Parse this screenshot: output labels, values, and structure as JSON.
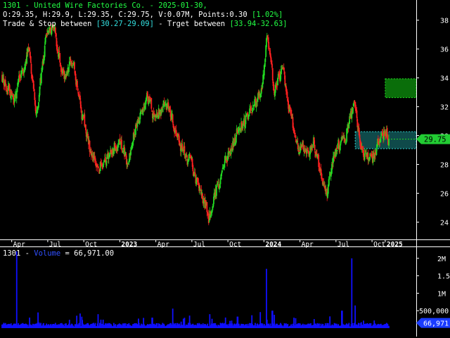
{
  "header": {
    "title": "1301 - United Wire Factories Co. - 2025-01-30,",
    "ohlc": "O:29.35, H:29.9, L:29.35, C:29.75, V:0.07M, Points:0.30",
    "change_pct": "[1.02%]",
    "trade_stop_label": "Trade & Stop between",
    "trade_stop_range": "[30.27-29.09]",
    "separator": " - ",
    "target_label": "Trget between",
    "target_range": "[33.94-32.63]"
  },
  "volume_header": {
    "symbol": "1301 - ",
    "label": "Volume",
    "value_text": " = 66,971.00"
  },
  "colors": {
    "background": "#000000",
    "up_candle": "#22dd22",
    "down_candle": "#ff2020",
    "volume_bar": "#1010ff",
    "trade_zone": "#0f4a4a",
    "target_zone": "#0a6e0a",
    "price_badge": "#22cc33",
    "volume_badge": "#1a3cff"
  },
  "chart_data": [
    {
      "type": "candlestick",
      "title": "1301 - United Wire Factories Co.",
      "x_tick_labels": [
        "Apr",
        "Jul",
        "Oct",
        "2023",
        "Apr",
        "Jul",
        "Oct",
        "2024",
        "Apr",
        "Jul",
        "Oct",
        "2025"
      ],
      "y_tick_labels": [
        "24",
        "26",
        "28",
        "30",
        "32",
        "34",
        "36",
        "38"
      ],
      "ylim": [
        22.8,
        39.4
      ],
      "last_price": 29.75,
      "last_price_label": "29.75",
      "trade_stop_zone": [
        29.09,
        30.27
      ],
      "target_zone": [
        32.63,
        33.94
      ],
      "trend_keypoints": [
        {
          "month": 0,
          "price": 34.3
        },
        {
          "month": 1,
          "price": 32.3
        },
        {
          "month": 2.2,
          "price": 36.4
        },
        {
          "month": 2.8,
          "price": 31.3
        },
        {
          "month": 3.6,
          "price": 36.6
        },
        {
          "month": 4.2,
          "price": 37.5
        },
        {
          "month": 5,
          "price": 34.3
        },
        {
          "month": 5.8,
          "price": 35.2
        },
        {
          "month": 6.5,
          "price": 32.0
        },
        {
          "month": 7.2,
          "price": 29.3
        },
        {
          "month": 8,
          "price": 27.5
        },
        {
          "month": 8.8,
          "price": 28.6
        },
        {
          "month": 9.8,
          "price": 29.6
        },
        {
          "month": 10.4,
          "price": 28.6
        },
        {
          "month": 11.2,
          "price": 30.8
        },
        {
          "month": 12,
          "price": 32.6
        },
        {
          "month": 12.8,
          "price": 31.2
        },
        {
          "month": 13.6,
          "price": 32.6
        },
        {
          "month": 14.6,
          "price": 29.6
        },
        {
          "month": 15.6,
          "price": 28.3
        },
        {
          "month": 16.5,
          "price": 26.2
        },
        {
          "month": 17.2,
          "price": 24.2
        },
        {
          "month": 17.8,
          "price": 26.2
        },
        {
          "month": 18.6,
          "price": 28.3
        },
        {
          "month": 19.6,
          "price": 30.2
        },
        {
          "month": 20.6,
          "price": 31.6
        },
        {
          "month": 21.6,
          "price": 32.8
        },
        {
          "month": 22,
          "price": 37.2
        },
        {
          "month": 22.6,
          "price": 33.2
        },
        {
          "month": 23.4,
          "price": 34.6
        },
        {
          "month": 24,
          "price": 31.1
        },
        {
          "month": 24.6,
          "price": 29.3
        },
        {
          "month": 25.4,
          "price": 28.8
        },
        {
          "month": 25.9,
          "price": 29.8
        },
        {
          "month": 26.5,
          "price": 27.2
        },
        {
          "month": 27,
          "price": 26.0
        },
        {
          "month": 27.6,
          "price": 28.6
        },
        {
          "month": 28.6,
          "price": 30.1
        },
        {
          "month": 29,
          "price": 31.6
        },
        {
          "month": 29.3,
          "price": 32.3
        },
        {
          "month": 29.8,
          "price": 29.2
        },
        {
          "month": 30.6,
          "price": 28.2
        },
        {
          "month": 31.2,
          "price": 29.2
        },
        {
          "month": 31.8,
          "price": 30.4
        },
        {
          "month": 32.1,
          "price": 29.75
        }
      ]
    },
    {
      "type": "bar",
      "title": "Volume",
      "y_tick_labels": [
        "500,000",
        "1M",
        "1.5M",
        "2M"
      ],
      "ylim": [
        0,
        2300000
      ],
      "last_value": 66971,
      "last_value_label": "66,971",
      "base_volume": 90000,
      "spikes": [
        {
          "month": 1.2,
          "value": 2200000
        },
        {
          "month": 3.0,
          "value": 450000
        },
        {
          "month": 6.5,
          "value": 420000
        },
        {
          "month": 8.0,
          "value": 400000
        },
        {
          "month": 12.5,
          "value": 300000
        },
        {
          "month": 14.2,
          "value": 560000
        },
        {
          "month": 15.6,
          "value": 360000
        },
        {
          "month": 17.3,
          "value": 400000
        },
        {
          "month": 19.6,
          "value": 330000
        },
        {
          "month": 21.5,
          "value": 460000
        },
        {
          "month": 22.0,
          "value": 1700000
        },
        {
          "month": 22.5,
          "value": 500000
        },
        {
          "month": 24.3,
          "value": 300000
        },
        {
          "month": 26.0,
          "value": 260000
        },
        {
          "month": 28.3,
          "value": 500000
        },
        {
          "month": 29.1,
          "value": 2000000
        },
        {
          "month": 29.4,
          "value": 650000
        },
        {
          "month": 31.0,
          "value": 220000
        }
      ]
    }
  ]
}
